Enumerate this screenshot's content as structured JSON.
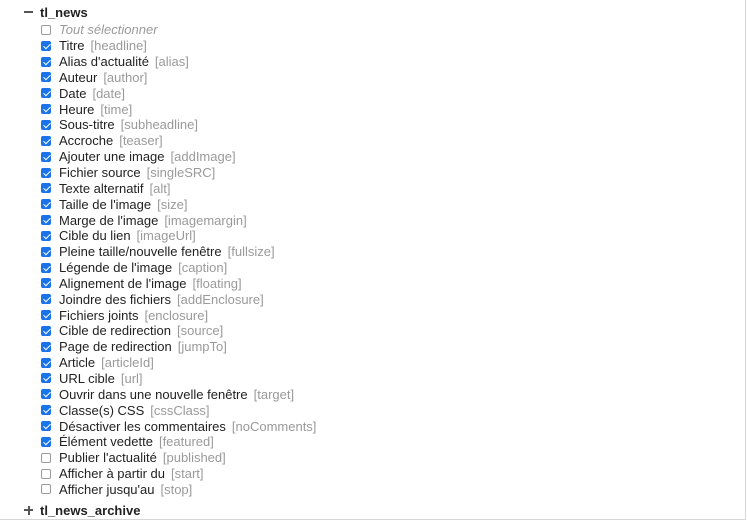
{
  "tables": [
    {
      "name": "tl_news",
      "state": "expanded",
      "toggle_icon": "minus-icon"
    },
    {
      "name": "tl_news_archive",
      "state": "collapsed",
      "toggle_icon": "plus-icon"
    }
  ],
  "select_all": {
    "label": "Tout sélectionner",
    "checked": false
  },
  "fields": [
    {
      "label": "Titre",
      "key": "[headline]",
      "checked": true
    },
    {
      "label": "Alias d'actualité",
      "key": "[alias]",
      "checked": true
    },
    {
      "label": "Auteur",
      "key": "[author]",
      "checked": true
    },
    {
      "label": "Date",
      "key": "[date]",
      "checked": true
    },
    {
      "label": "Heure",
      "key": "[time]",
      "checked": true
    },
    {
      "label": "Sous-titre",
      "key": "[subheadline]",
      "checked": true
    },
    {
      "label": "Accroche",
      "key": "[teaser]",
      "checked": true
    },
    {
      "label": "Ajouter une image",
      "key": "[addImage]",
      "checked": true
    },
    {
      "label": "Fichier source",
      "key": "[singleSRC]",
      "checked": true
    },
    {
      "label": "Texte alternatif",
      "key": "[alt]",
      "checked": true
    },
    {
      "label": "Taille de l'image",
      "key": "[size]",
      "checked": true
    },
    {
      "label": "Marge de l'image",
      "key": "[imagemargin]",
      "checked": true
    },
    {
      "label": "Cible du lien",
      "key": "[imageUrl]",
      "checked": true
    },
    {
      "label": "Pleine taille/nouvelle fenêtre",
      "key": "[fullsize]",
      "checked": true
    },
    {
      "label": "Légende de l'image",
      "key": "[caption]",
      "checked": true
    },
    {
      "label": "Alignement de l'image",
      "key": "[floating]",
      "checked": true
    },
    {
      "label": "Joindre des fichiers",
      "key": "[addEnclosure]",
      "checked": true
    },
    {
      "label": "Fichiers joints",
      "key": "[enclosure]",
      "checked": true
    },
    {
      "label": "Cible de redirection",
      "key": "[source]",
      "checked": true
    },
    {
      "label": "Page de redirection",
      "key": "[jumpTo]",
      "checked": true
    },
    {
      "label": "Article",
      "key": "[articleId]",
      "checked": true
    },
    {
      "label": "URL cible",
      "key": "[url]",
      "checked": true
    },
    {
      "label": "Ouvrir dans une nouvelle fenêtre",
      "key": "[target]",
      "checked": true
    },
    {
      "label": "Classe(s) CSS",
      "key": "[cssClass]",
      "checked": true
    },
    {
      "label": "Désactiver les commentaires",
      "key": "[noComments]",
      "checked": true
    },
    {
      "label": "Élément vedette",
      "key": "[featured]",
      "checked": true
    },
    {
      "label": "Publier l'actualité",
      "key": "[published]",
      "checked": false
    },
    {
      "label": "Afficher à partir du",
      "key": "[start]",
      "checked": false
    },
    {
      "label": "Afficher jusqu'au",
      "key": "[stop]",
      "checked": false
    }
  ],
  "colors": {
    "checkbox_checked": "#1a73e8",
    "key_text": "#9a9a9a",
    "label_text": "#222222"
  }
}
